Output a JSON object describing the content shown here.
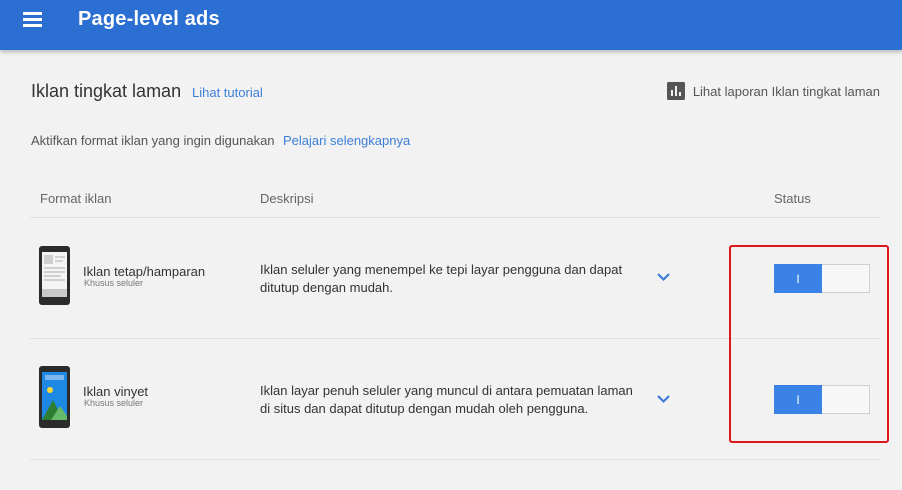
{
  "colors": {
    "header": "#2a6fd1",
    "link": "#3d7fd6",
    "toggle_on": "#3b82e6",
    "highlight": "#e0161c"
  },
  "header": {
    "menu_icon": "hamburger-menu-icon",
    "title": "Page-level ads"
  },
  "page": {
    "heading": "Iklan tingkat laman",
    "tutorial_link": "Lihat tutorial",
    "report_icon": "bar-chart-icon",
    "report_link": "Lihat laporan Iklan tingkat laman",
    "instruction": "Aktifkan format iklan yang ingin digunakan",
    "learn_more_link": "Pelajari selengkapnya"
  },
  "table": {
    "columns": {
      "format": "Format iklan",
      "description": "Deskripsi",
      "status": "Status"
    },
    "rows": [
      {
        "title": "Iklan tetap/hamparan",
        "subtitle": "Khusus seluler",
        "description": "Iklan seluler yang menempel ke tepi layar pengguna dan dapat ditutup dengan mudah.",
        "toggle_label": "I",
        "enabled": true
      },
      {
        "title": "Iklan vinyet",
        "subtitle": "Khusus seluler",
        "description": "Iklan layar penuh seluler yang muncul di antara pemuatan laman di situs dan dapat ditutup dengan mudah oleh pengguna.",
        "toggle_label": "I",
        "enabled": true
      }
    ]
  }
}
